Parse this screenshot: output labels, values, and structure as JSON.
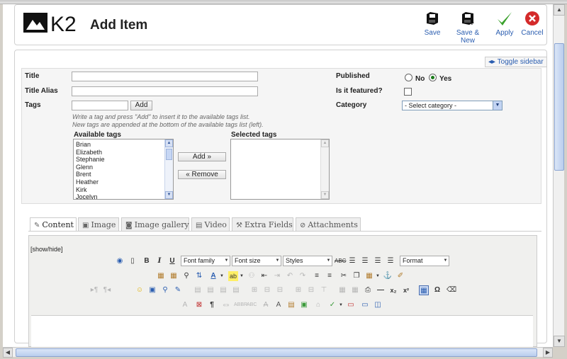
{
  "header": {
    "title": "Add Item",
    "logo_text": "K2",
    "actions": [
      {
        "key": "save",
        "label": "Save"
      },
      {
        "key": "save_new",
        "label": "Save & New"
      },
      {
        "key": "apply",
        "label": "Apply"
      },
      {
        "key": "cancel",
        "label": "Cancel"
      }
    ]
  },
  "toggle_sidebar": "Toggle sidebar",
  "form": {
    "title_label": "Title",
    "title_value": "",
    "alias_label": "Title Alias",
    "alias_value": "",
    "tags_label": "Tags",
    "tags_value": "",
    "add_button": "Add",
    "hint_line1": "Write a tag and press \"Add\" to insert it to the available tags list.",
    "hint_line2": "New tags are appended at the bottom of the available tags list (left).",
    "available_tags_label": "Available tags",
    "available_tags": [
      "Brian",
      "Elizabeth",
      "Stephanie",
      "Glenn",
      "Brent",
      "Heather",
      "Kirk",
      "Jocelyn"
    ],
    "selected_tags_label": "Selected tags",
    "add_tag_button": "Add »",
    "remove_tag_button": "« Remove",
    "published_label": "Published",
    "published_options": [
      "No",
      "Yes"
    ],
    "published_selected": "Yes",
    "featured_label": "Is it featured?",
    "featured_checked": false,
    "category_label": "Category",
    "category_value": "- Select category -"
  },
  "tabs": [
    {
      "label": "Content",
      "icon": "edit-icon",
      "active": true
    },
    {
      "label": "Image",
      "icon": "image-icon",
      "active": false
    },
    {
      "label": "Image gallery",
      "icon": "camera-icon",
      "active": false
    },
    {
      "label": "Video",
      "icon": "film-icon",
      "active": false
    },
    {
      "label": "Extra Fields",
      "icon": "fields-icon",
      "active": false
    },
    {
      "label": "Attachments",
      "icon": "paperclip-icon",
      "active": false
    }
  ],
  "editor": {
    "show_hide": "[show/hide]",
    "font_family": "Font family",
    "font_size": "Font size",
    "styles": "Styles",
    "format": "Format"
  }
}
